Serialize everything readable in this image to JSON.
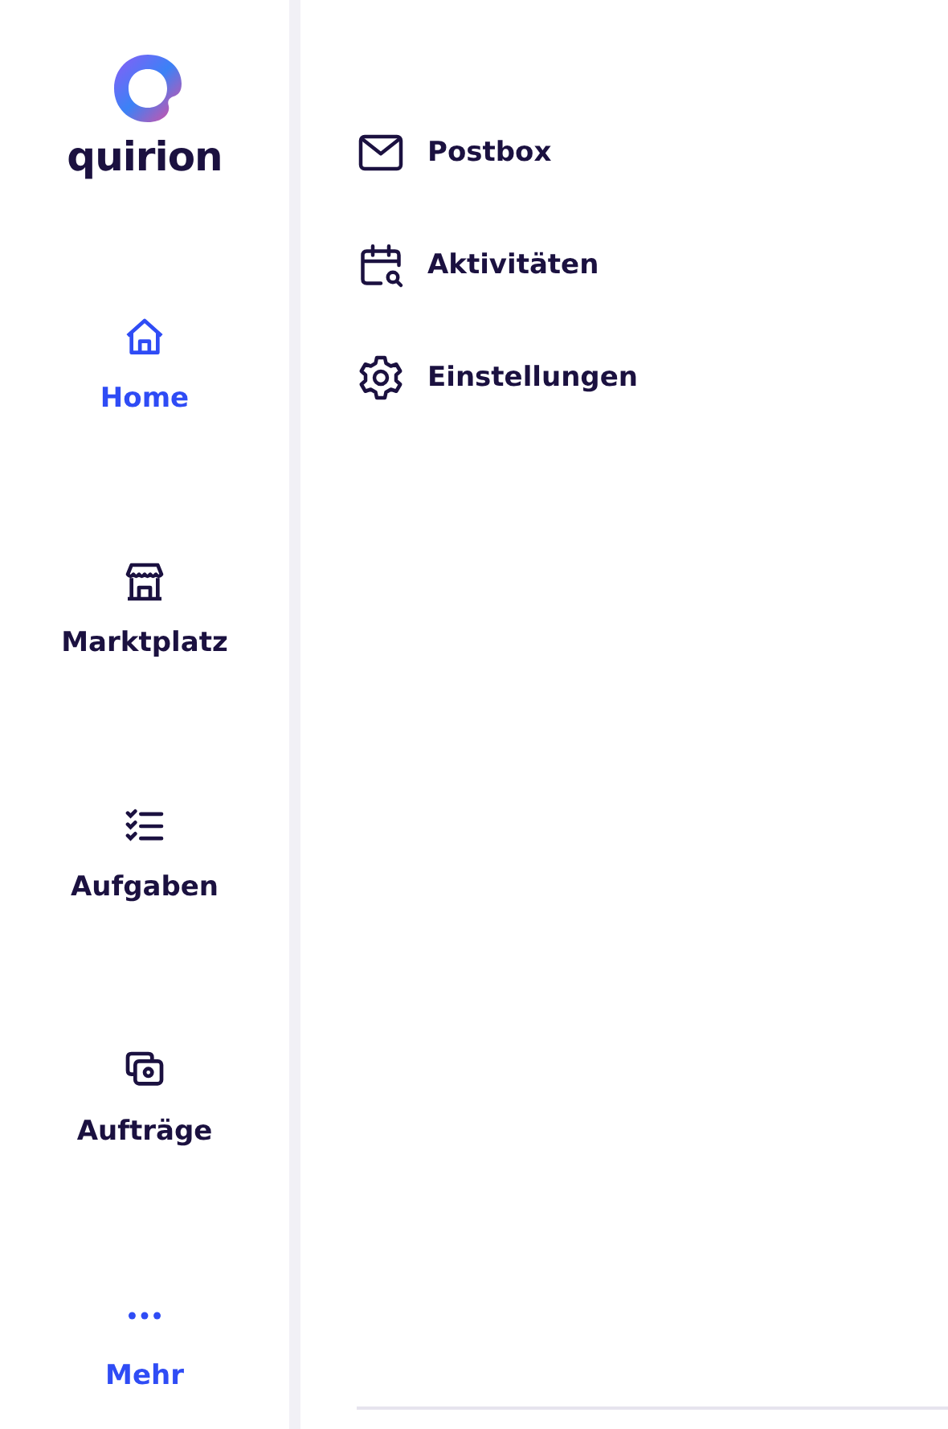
{
  "logo": {
    "text": "quirion"
  },
  "nav": [
    {
      "label": "Home",
      "kind": "home",
      "selected": true
    },
    {
      "label": "Marktplatz",
      "kind": "store",
      "selected": false
    },
    {
      "label": "Aufgaben",
      "kind": "checklist",
      "selected": false
    },
    {
      "label": "Aufträge",
      "kind": "money",
      "selected": false
    },
    {
      "label": "Mehr",
      "kind": "more",
      "selected": true
    }
  ],
  "menu": [
    {
      "label": "Postbox",
      "kind": "mail"
    },
    {
      "label": "Aktivitäten",
      "kind": "calendar"
    },
    {
      "label": "Einstellungen",
      "kind": "settings"
    }
  ]
}
